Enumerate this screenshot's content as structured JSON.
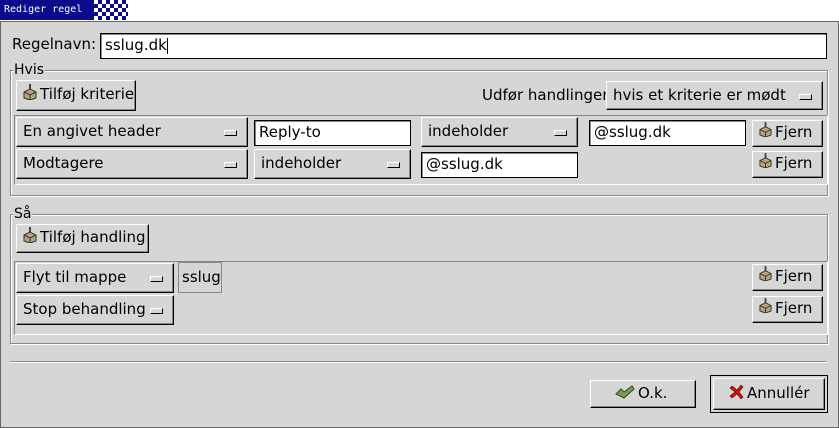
{
  "window": {
    "title": "Rediger regel"
  },
  "rule_name": {
    "label": "Regelnavn:",
    "value": "sslug.dk"
  },
  "if_section": {
    "title": "Hvis",
    "add_criterion_label": "Tilføj kriterie",
    "execute_label": "Udfør handlinger",
    "execute_option": "hvis et kriterie er mødt",
    "criteria": [
      {
        "field": "En angivet header",
        "header_name": "Reply-to",
        "operator": "indeholder",
        "value": "@sslug.dk",
        "remove_label": "Fjern"
      },
      {
        "field": "Modtagere",
        "operator": "indeholder",
        "value": "@sslug.dk",
        "remove_label": "Fjern"
      }
    ]
  },
  "then_section": {
    "title": "Så",
    "add_action_label": "Tilføj handling",
    "actions": [
      {
        "action": "Flyt til mappe",
        "folder": "sslug",
        "remove_label": "Fjern"
      },
      {
        "action": "Stop behandling",
        "remove_label": "Fjern"
      }
    ]
  },
  "buttons": {
    "ok_label": "O.k.",
    "cancel_label": "Annullér"
  },
  "icons": {
    "add": "plunger-icon",
    "remove": "plunger-icon",
    "ok": "ok-check-icon",
    "cancel": "red-x-icon"
  }
}
